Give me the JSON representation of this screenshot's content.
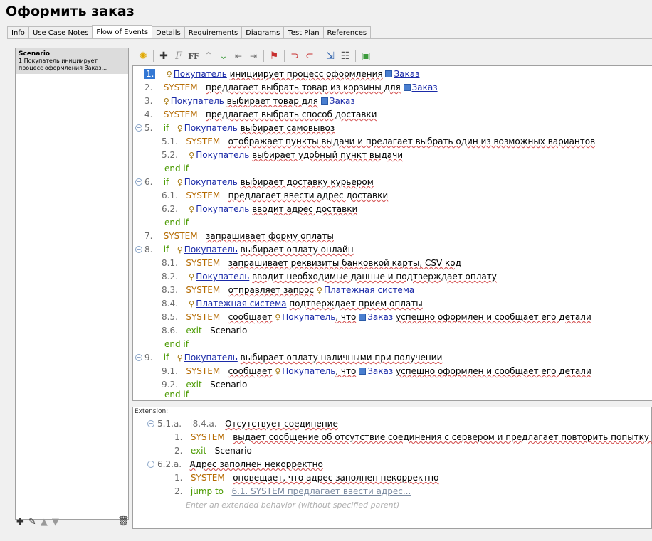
{
  "window": {
    "title": "Оформить заказ"
  },
  "tabs": [
    {
      "label": "Info"
    },
    {
      "label": "Use Case Notes"
    },
    {
      "label": "Flow of Events"
    },
    {
      "label": "Details"
    },
    {
      "label": "Requirements"
    },
    {
      "label": "Diagrams"
    },
    {
      "label": "Test Plan"
    },
    {
      "label": "References"
    }
  ],
  "left_panel": {
    "heading": "Scenario",
    "line1": "1.Покупатель инициирует",
    "line2": "процесс оформления Заказ..."
  },
  "actors": {
    "buyer": "Покупатель",
    "payment": "Платежная система",
    "order": "Заказ"
  },
  "flow": {
    "r1_num": "1.",
    "r1_text": "инициирует процесс оформления",
    "r2_num": "2.",
    "r2_sys": "SYSTEM",
    "r2_text": "предлагает выбрать товар из корзины для",
    "r3_num": "3.",
    "r3_text": "выбирает товар для",
    "r4_num": "4.",
    "r4_sys": "SYSTEM",
    "r4_text": "предлагает выбрать способ доставки",
    "r5_num": "5.",
    "r5_kw": "if",
    "r5_text": "выбирает самовывоз",
    "r51_num": "5.1.",
    "r51_sys": "SYSTEM",
    "r51_text": "отображает пункты выдачи и прелагает выбрать один из возможных вариантов",
    "r52_num": "5.2.",
    "r52_text": "выбирает удобный пункт выдачи",
    "r5_end": "end if",
    "r6_num": "6.",
    "r6_kw": "if",
    "r6_text": "выбирает доставку курьером",
    "r61_num": "6.1.",
    "r61_sys": "SYSTEM",
    "r61_text": "предлагает ввести адрес доставки",
    "r62_num": "6.2.",
    "r62_text": "вводит адрес доставки",
    "r6_end": "end if",
    "r7_num": "7.",
    "r7_sys": "SYSTEM",
    "r7_text": "запрашивает форму оплаты",
    "r8_num": "8.",
    "r8_kw": "if",
    "r8_text": "выбирает оплату онлайн",
    "r81_num": "8.1.",
    "r81_sys": "SYSTEM",
    "r81_text": "запрашивает реквизиты банковкой карты, CSV код",
    "r82_num": "8.2.",
    "r82_text": "вводит необходимые данные и подтверждает оплату",
    "r83_num": "8.3.",
    "r83_sys": "SYSTEM",
    "r83_text": "отправляет запрос",
    "r84_num": "8.4.",
    "r84_text": "подтверждает прием оплаты",
    "r85_num": "8.5.",
    "r85_sys": "SYSTEM",
    "r85_text": "сообщает",
    "r85_mid": ", что",
    "r85_tail": "успешно оформлен и сообщает его детали",
    "r86_num": "8.6.",
    "r86_kw": "exit",
    "r86_text": "Scenario",
    "r8_end": "end if",
    "r9_num": "9.",
    "r9_kw": "if",
    "r9_text": "выбирает оплату наличными при получении",
    "r91_num": "9.1.",
    "r91_sys": "SYSTEM",
    "r91_text": "сообщает",
    "r91_mid": ", что",
    "r91_tail": "успешно оформлен и сообщает его детали",
    "r92_num": "9.2.",
    "r92_kw": "exit",
    "r92_text": "Scenario",
    "r9_end": "end if"
  },
  "extension": {
    "label": "Extension:",
    "e1_id": "5.1.a.",
    "e1_ref": "|8.4.a.",
    "e1_title": "Отсутствует соединение",
    "e1_1_num": "1.",
    "e1_1_sys": "SYSTEM",
    "e1_1_text": "выдает сообщение об отсутствие соединения с сервером и предлагает повторить попытку позже",
    "e1_2_num": "2.",
    "e1_2_kw": "exit",
    "e1_2_text": "Scenario",
    "e2_id": "6.2.a.",
    "e2_title": "Адрес заполнен некорректно",
    "e2_1_num": "1.",
    "e2_1_sys": "SYSTEM",
    "e2_1_text": "оповещает, что адрес заполнен некорректно",
    "e2_2_num": "2.",
    "e2_2_kw": "jump to",
    "e2_2_link": "6.1. SYSTEM предлагает ввести адрес...",
    "placeholder": "Enter an extended behavior (without specified parent)"
  },
  "colors": {
    "system": "#b56a00",
    "keyword": "#4a9a00",
    "actor_link": "#1a2aa8",
    "selection": "#3478d4"
  }
}
